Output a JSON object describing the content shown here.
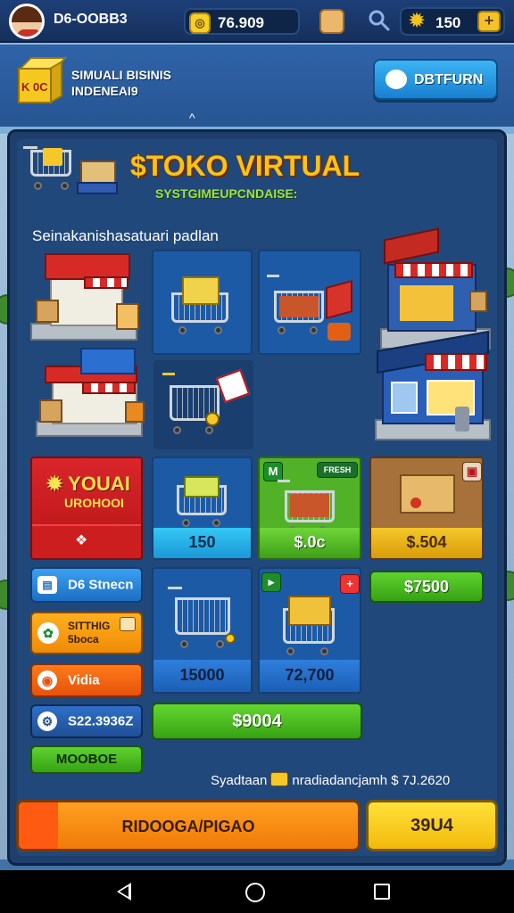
{
  "topbar": {
    "player_name": "D6-OOBB3",
    "coins": "76.909",
    "gems": "150",
    "plus_label": "+"
  },
  "header": {
    "logo_text": "K 0C",
    "sim_title_line1": "SIMUALI BISINIS",
    "sim_title_line2": "INDENEAI9",
    "return_label": "DBTFURN",
    "caret": "^"
  },
  "store": {
    "title": "$TOKO VIRTUAL",
    "subtitle": "SYSTGIMEUPCNDAISE:",
    "section_label": "Seinakanishasatuari padlan"
  },
  "items": {
    "promo": {
      "title": "YOUAI",
      "subtitle": "UROHOOI",
      "icon": "❖"
    },
    "cart_price_1": "150",
    "cart_price_2": "$.0c",
    "box_price": "$.504",
    "price_right": "$7500",
    "cart_price_3": "15000",
    "cart_price_4": "72,700",
    "wide_price": "$9004",
    "badge_left": "M",
    "badge_right": "FRESH"
  },
  "menu": {
    "btn1": "D6 Stnecn",
    "btn2a": "SITTHIG",
    "btn2b": "5boca",
    "btn3": "Vidia",
    "btn4": "S22.3936Z",
    "btn5": "MOOBOE"
  },
  "footer": {
    "left_text": "Syadtaan",
    "right_text": "nradiadancjamh $ 7J.2620",
    "main_button": "RIDOOGA/PIGAO",
    "side_button": "39U4"
  },
  "colors": {
    "title_gold": "#f7c21c",
    "subtitle_green": "#9be34a",
    "panel": "#21487b"
  }
}
